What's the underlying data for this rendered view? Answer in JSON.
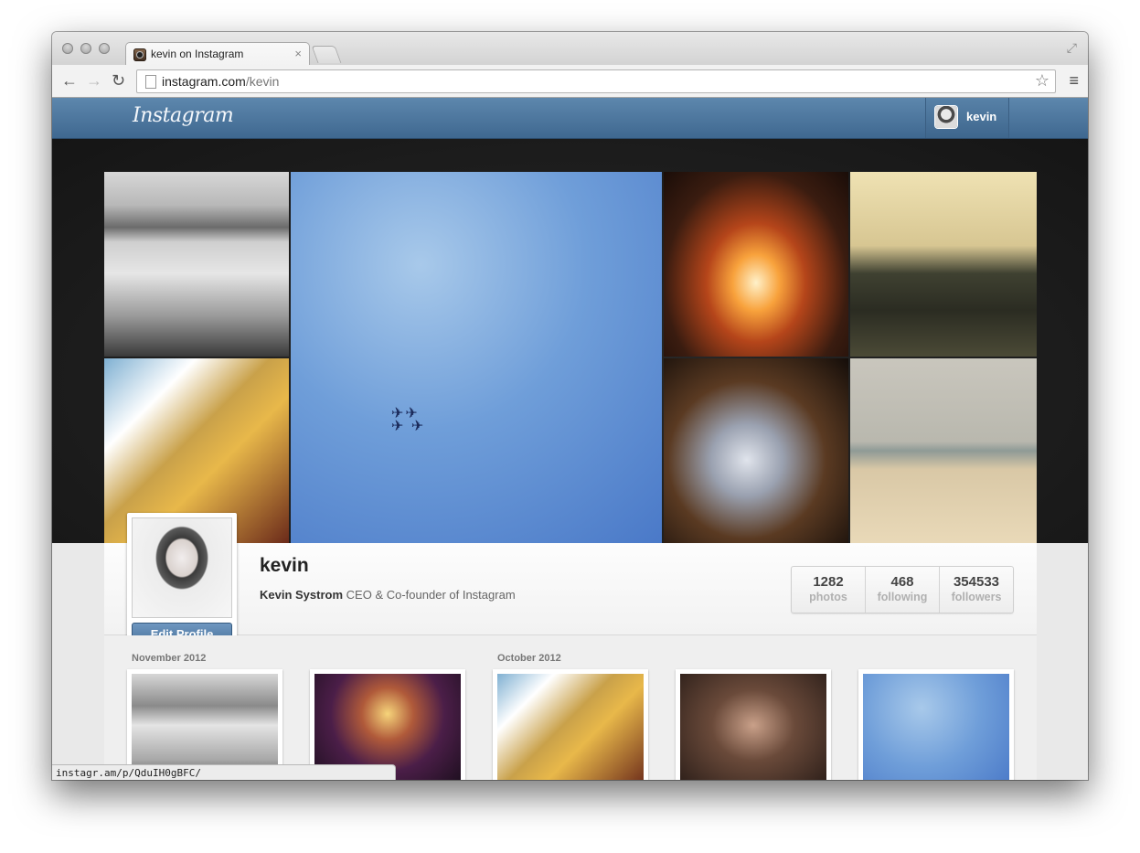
{
  "browser": {
    "tab_title": "kevin on Instagram",
    "tab_close": "×",
    "url_host": "instagram.com",
    "url_path": "/kevin",
    "status_url": "instagr.am/p/QduIH0gBFC/"
  },
  "header": {
    "logo": "Instagram",
    "user_name": "kevin"
  },
  "profile": {
    "username": "kevin",
    "full_name": "Kevin Systrom",
    "bio": "CEO & Co-founder of Instagram",
    "edit_button": "Edit Profile",
    "stats": [
      {
        "value": "1282",
        "label": "photos"
      },
      {
        "value": "468",
        "label": "following"
      },
      {
        "value": "354533",
        "label": "followers"
      }
    ]
  },
  "feed": {
    "months": [
      "November 2012",
      "October 2012"
    ]
  },
  "colors": {
    "header_blue": "#4a729a",
    "button_blue": "#5a83ad",
    "page_bg": "#efefef"
  },
  "icons": [
    "back-icon",
    "forward-icon",
    "reload-icon",
    "page-icon",
    "star-icon",
    "menu-icon",
    "fullscreen-icon",
    "favicon-icon"
  ]
}
